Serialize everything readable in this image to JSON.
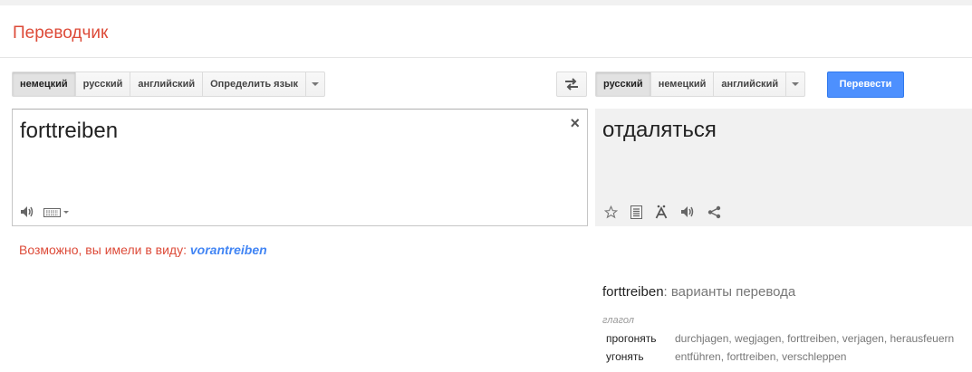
{
  "app": {
    "title": "Переводчик"
  },
  "source_langs": [
    "немецкий",
    "русский",
    "английский",
    "Определить язык"
  ],
  "target_langs": [
    "русский",
    "немецкий",
    "английский"
  ],
  "translate_button": "Перевести",
  "source": {
    "text": "forttreiben",
    "clear": "×"
  },
  "result": {
    "text": "отдаляться"
  },
  "suggestion": {
    "prefix": "Возможно, вы имели в виду:",
    "link": "vorantreiben"
  },
  "dictionary": {
    "word": "forttreiben",
    "subtitle": ": варианты перевода",
    "pos": "глагол",
    "rows": [
      {
        "word": "прогонять",
        "synonyms": "durchjagen, wegjagen, forttreiben, verjagen, herausfeuern"
      },
      {
        "word": "угонять",
        "synonyms": "entführen, forttreiben, verschleppen"
      }
    ]
  },
  "colors": {
    "accent": "#dd4b39",
    "button": "#4d90fe",
    "link": "#4285f4"
  }
}
